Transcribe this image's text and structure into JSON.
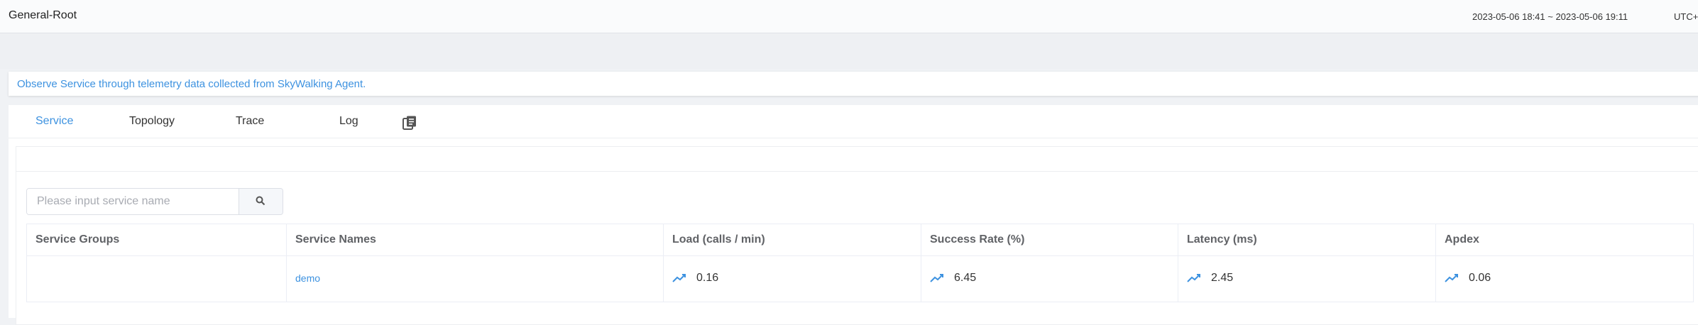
{
  "header": {
    "title": "General-Root",
    "time_range": "2023-05-06 18:41 ~ 2023-05-06 19:11",
    "timezone": "UTC+"
  },
  "description": "Observe Service through telemetry data collected from SkyWalking Agent.",
  "tabs": [
    {
      "label": "Service",
      "active": true
    },
    {
      "label": "Topology"
    },
    {
      "label": "Trace"
    },
    {
      "label": "Log"
    }
  ],
  "icons": {
    "copy": "copy-icon",
    "search": "search-icon",
    "trend": "trend-line-icon"
  },
  "search": {
    "placeholder": "Please input service name",
    "value": ""
  },
  "table": {
    "columns": [
      "Service Groups",
      "Service Names",
      "Load (calls / min)",
      "Success Rate (%)",
      "Latency (ms)",
      "Apdex"
    ],
    "rows": [
      {
        "group": "",
        "name": "demo",
        "load": "0.16",
        "success_rate": "6.45",
        "latency": "2.45",
        "apdex": "0.06"
      }
    ]
  },
  "colors": {
    "accent": "#3d92e0",
    "background": "#f0f2f5"
  }
}
